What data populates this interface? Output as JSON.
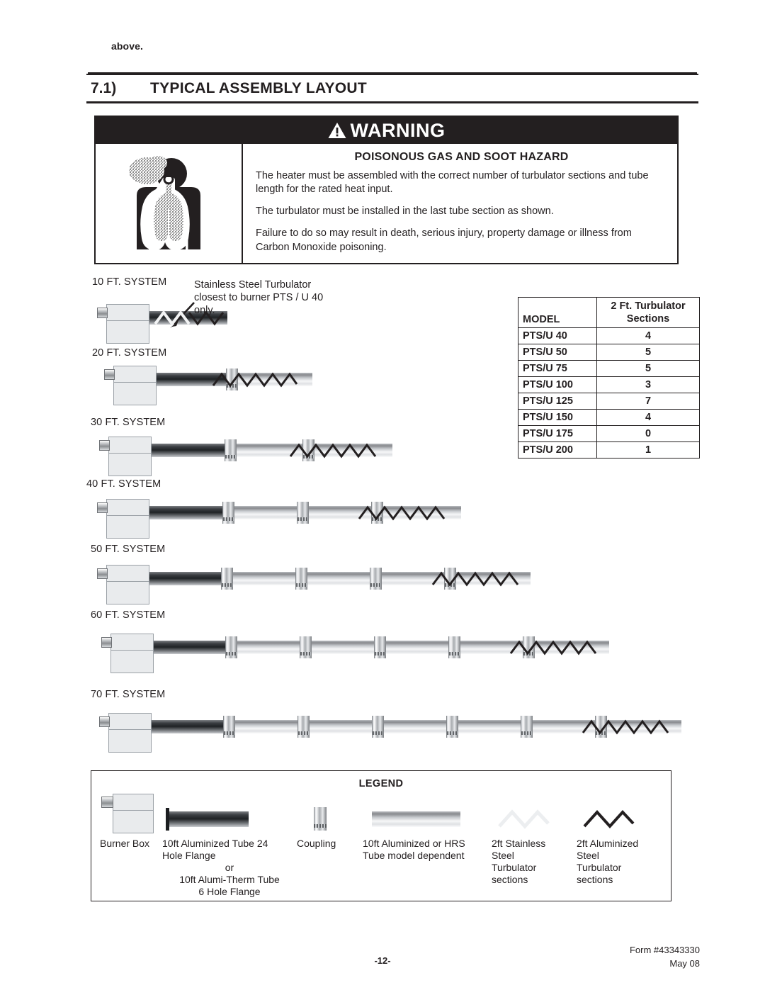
{
  "running_text": "above.",
  "section": {
    "number": "7.1)",
    "title": "TYPICAL ASSEMBLY LAYOUT"
  },
  "warning": {
    "banner_label": "WARNING",
    "banner_icon": "warning-triangle-icon",
    "pictogram": "poison-gas-lungs-icon",
    "title": "POISONOUS GAS AND SOOT HAZARD",
    "paragraphs": [
      "The heater must be assembled with the correct number of turbulator sections and tube length for the rated heat input.",
      "The turbulator must be installed in the last tube section as shown.",
      "Failure to do so may result in death, serious injury, property damage or illness from Carbon Monoxide poisoning."
    ]
  },
  "callout": {
    "text": "Stainless Steel Turbulator closest to burner PTS / U 40 only.",
    "arrow_icon": "callout-arrow-icon"
  },
  "systems": [
    {
      "label": "10 FT. SYSTEM"
    },
    {
      "label": "20 FT. SYSTEM"
    },
    {
      "label": "30 FT. SYSTEM"
    },
    {
      "label": "40 FT. SYSTEM"
    },
    {
      "label": "50 FT. SYSTEM"
    },
    {
      "label": "60 FT. SYSTEM"
    },
    {
      "label": "70 FT. SYSTEM"
    }
  ],
  "table": {
    "header_model": "MODEL",
    "header_sections_line1": "2 Ft. Turbulator",
    "header_sections_line2": "Sections",
    "rows": [
      {
        "model": "PTS/U 40",
        "sections": "4"
      },
      {
        "model": "PTS/U 50",
        "sections": "5"
      },
      {
        "model": "PTS/U 75",
        "sections": "5"
      },
      {
        "model": "PTS/U 100",
        "sections": "3"
      },
      {
        "model": "PTS/U 125",
        "sections": "7"
      },
      {
        "model": "PTS/U 150",
        "sections": "4"
      },
      {
        "model": "PTS/U 175",
        "sections": "0"
      },
      {
        "model": "PTS/U 200",
        "sections": "1"
      }
    ]
  },
  "legend": {
    "title": "LEGEND",
    "items": [
      {
        "icon": "burner-box-icon",
        "line1": "Burner Box",
        "line2": "",
        "line3": "",
        "line4": "",
        "line5": ""
      },
      {
        "icon": "aluminized-tube-flange-icon",
        "line1": "10ft Aluminized Tube 24",
        "line2": "Hole Flange",
        "line3": "or",
        "line4": "10ft Alumi-Therm Tube",
        "line5": "6 Hole Flange"
      },
      {
        "icon": "coupling-icon",
        "line1": "Coupling",
        "line2": "",
        "line3": "",
        "line4": "",
        "line5": ""
      },
      {
        "icon": "hrs-tube-icon",
        "line1": "10ft Aluminized or HRS",
        "line2": "Tube  model dependent",
        "line3": "",
        "line4": "",
        "line5": ""
      },
      {
        "icon": "stainless-turbulator-icon",
        "line1": "2ft Stainless",
        "line2": "Steel",
        "line3": "Turbulator",
        "line4": "sections",
        "line5": ""
      },
      {
        "icon": "aluminized-turbulator-icon",
        "line1": "2ft Aluminized",
        "line2": "Steel",
        "line3": "Turbulator",
        "line4": "sections",
        "line5": ""
      }
    ]
  },
  "footer": {
    "page_number": "-12-",
    "form": "Form #43343330",
    "date": "May 08"
  },
  "colors": {
    "ink": "#231f20",
    "banner_bg": "#231f20",
    "banner_text": "#ffffff",
    "metal_light": "#e9ebed"
  }
}
